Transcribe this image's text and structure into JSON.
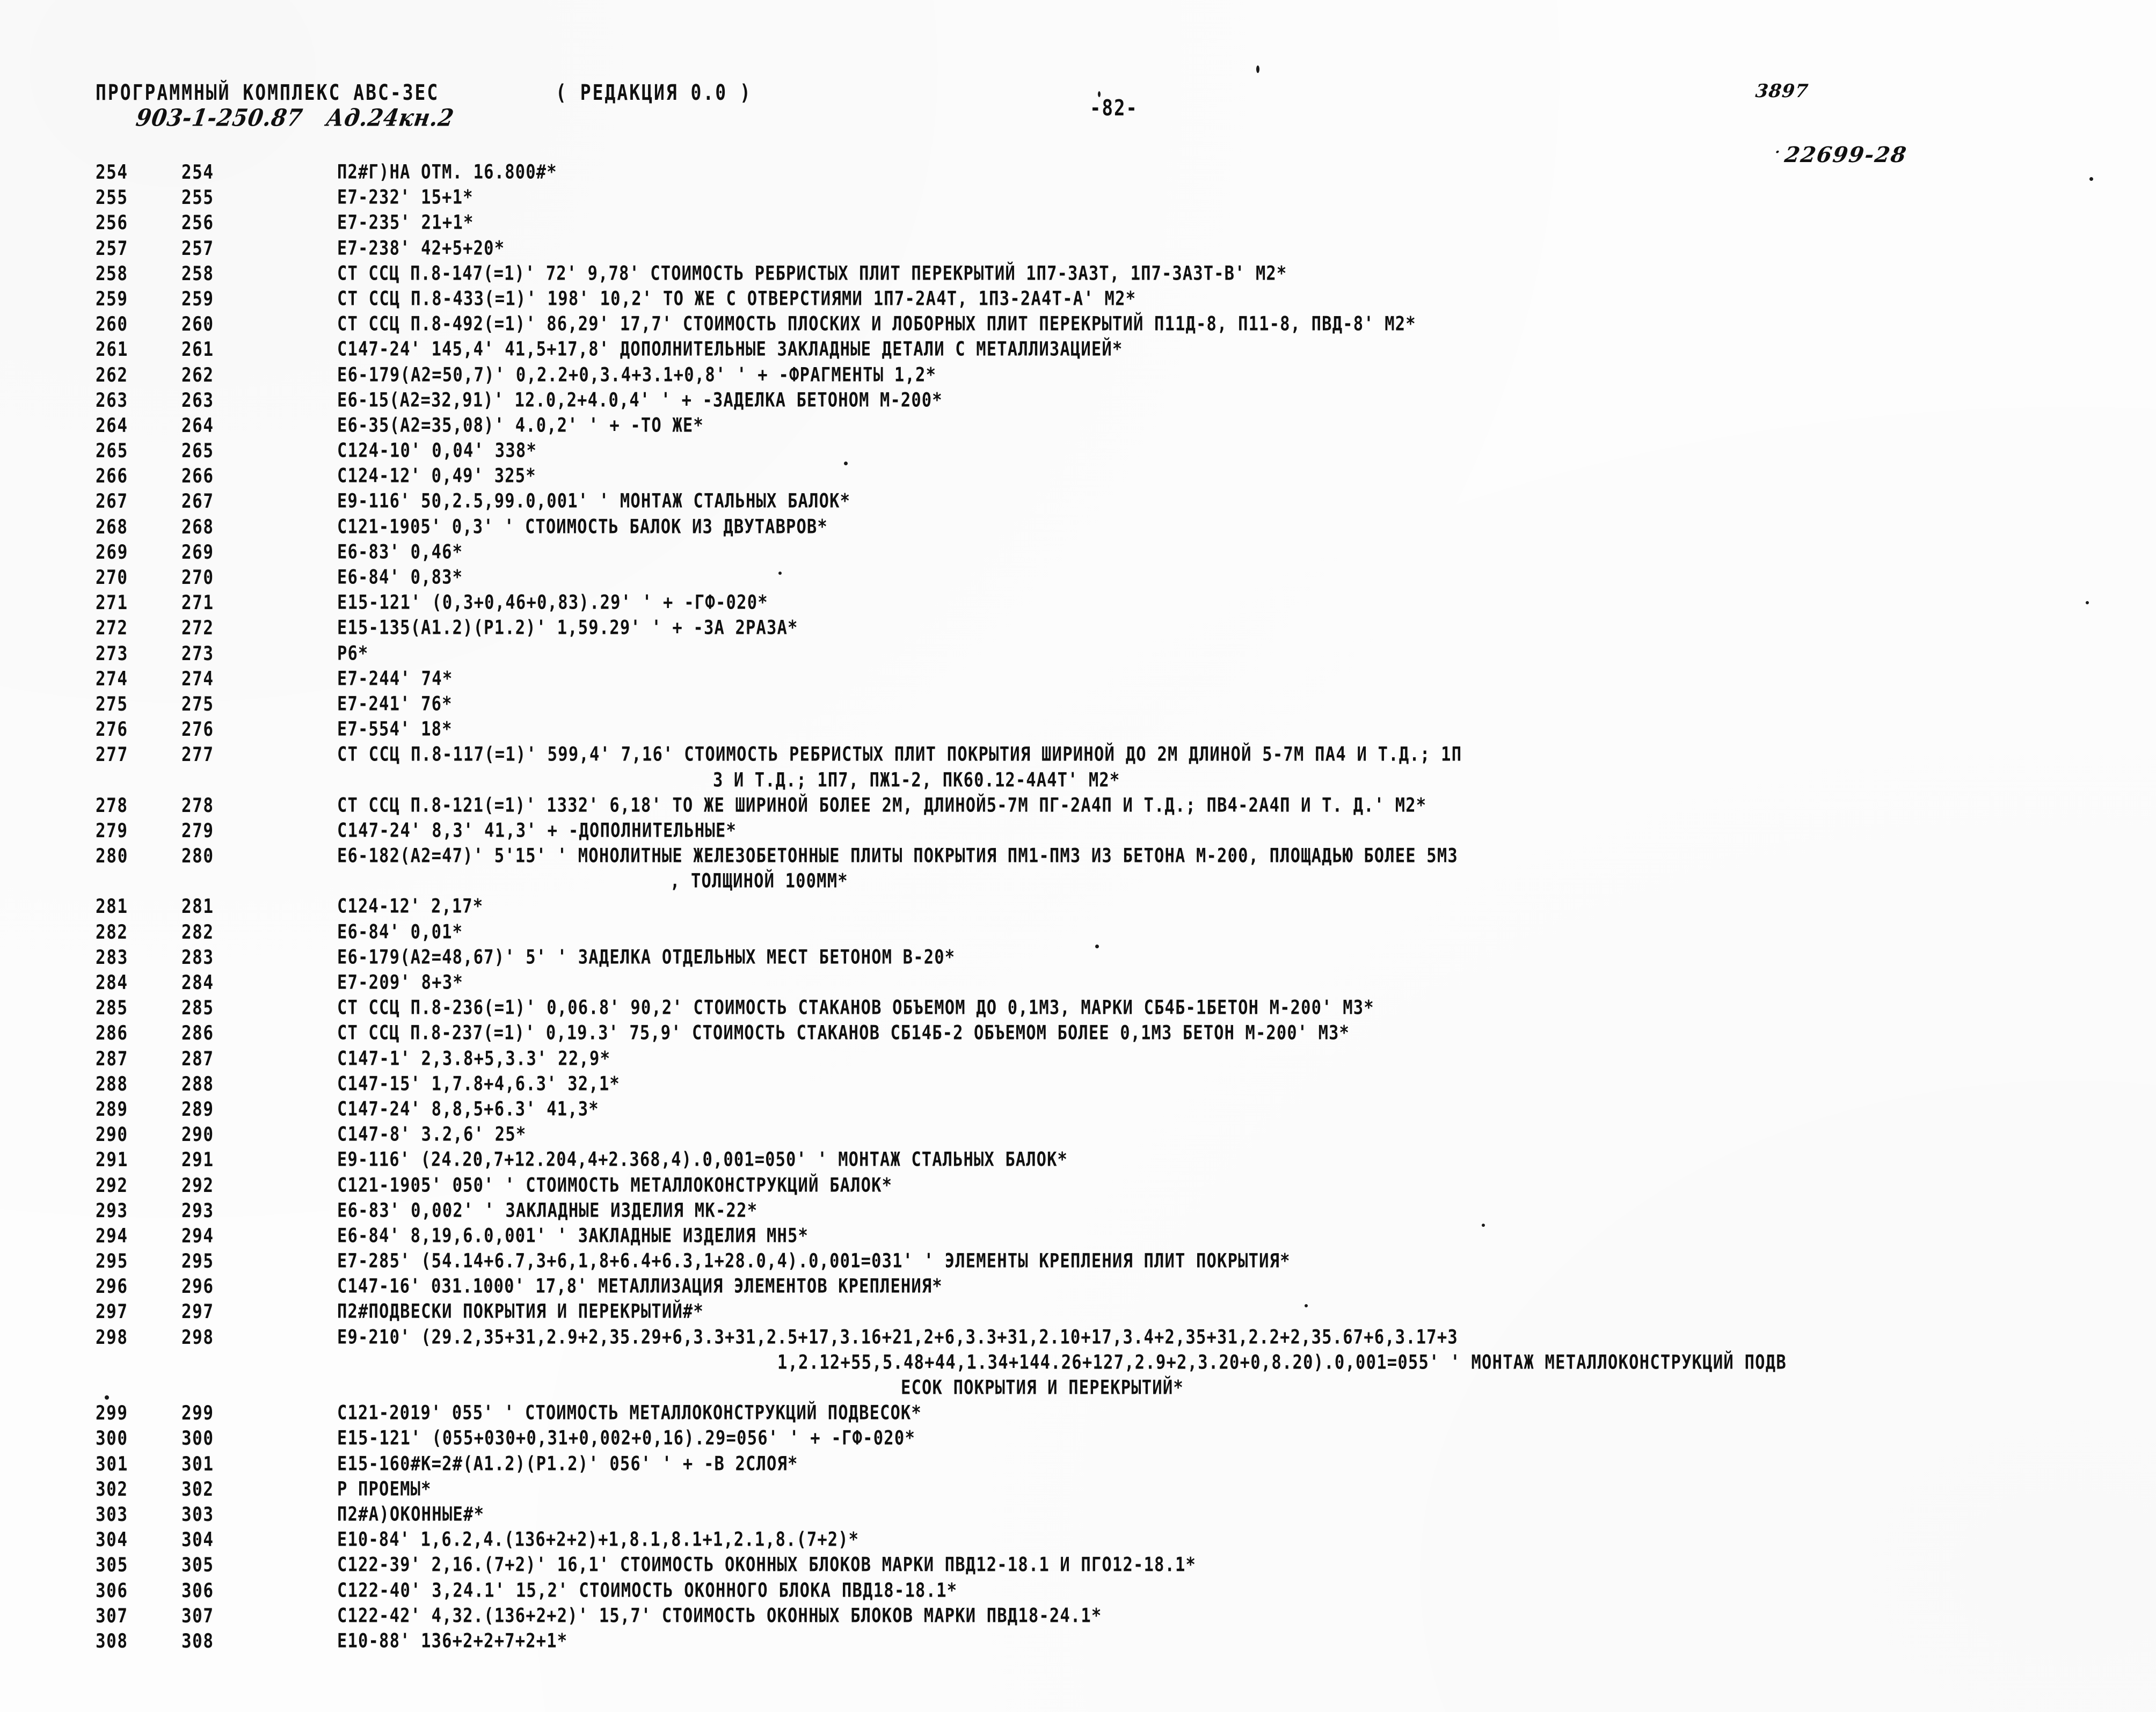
{
  "document": {
    "kind": "scanned-program-listing",
    "page_number_label": "-82-"
  },
  "header": {
    "complex_title": "ПРОГРАММНЫЙ КОМПЛЕКС АВС-3ЕС",
    "redaction": "( РЕДАКЦИЯ 0.0 )",
    "handwritten_annotation": "903-1-250.87   Ад.24кн.2",
    "page_number": "-82-",
    "code_top": "3897",
    "code_sub_tick": "·",
    "code_sub": "22699-28"
  },
  "listing": {
    "rows": [
      {
        "n1": "254",
        "n2": "254",
        "text": "П2#Г)НА ОТМ. 16.800#*"
      },
      {
        "n1": "255",
        "n2": "255",
        "text": "Е7-232' 15+1*"
      },
      {
        "n1": "256",
        "n2": "256",
        "text": "Е7-235' 21+1*"
      },
      {
        "n1": "257",
        "n2": "257",
        "text": "Е7-238' 42+5+20*"
      },
      {
        "n1": "258",
        "n2": "258",
        "text": "СТ ССЦ П.8-147(=1)' 72' 9,78' СТОИМОСТЬ РЕБРИСТЫХ ПЛИТ ПЕРЕКРЫТИЙ 1П7-3А3Т, 1П7-3А3Т-В' М2*"
      },
      {
        "n1": "259",
        "n2": "259",
        "text": "СТ ССЦ П.8-433(=1)' 198' 10,2' ТО ЖЕ С ОТВЕРСТИЯМИ 1П7-2А4Т, 1П3-2А4Т-А' М2*"
      },
      {
        "n1": "260",
        "n2": "260",
        "text": "СТ ССЦ П.8-492(=1)' 86,29' 17,7' СТОИМОСТЬ ПЛОСКИХ И ЛОБОРНЫХ ПЛИТ ПЕРЕКРЫТИЙ П11Д-8, П11-8, ПВД-8' М2*"
      },
      {
        "n1": "261",
        "n2": "261",
        "text": "С147-24' 145,4' 41,5+17,8' ДОПОЛНИТЕЛЬНЫЕ ЗАКЛАДНЫЕ ДЕТАЛИ С МЕТАЛЛИЗАЦИЕЙ*"
      },
      {
        "n1": "262",
        "n2": "262",
        "text": "Е6-179(А2=50,7)' 0,2.2+0,3.4+3.1+0,8' ' + -ФРАГМЕНТЫ 1,2*"
      },
      {
        "n1": "263",
        "n2": "263",
        "text": "Е6-15(А2=32,91)' 12.0,2+4.0,4' ' + -ЗАДЕЛКА БЕТОНОМ М-200*"
      },
      {
        "n1": "264",
        "n2": "264",
        "text": "Е6-35(А2=35,08)' 4.0,2' ' + -ТО ЖЕ*"
      },
      {
        "n1": "265",
        "n2": "265",
        "text": "С124-10' 0,04' 338*"
      },
      {
        "n1": "266",
        "n2": "266",
        "text": "С124-12' 0,49' 325*"
      },
      {
        "n1": "267",
        "n2": "267",
        "text": "Е9-116' 50,2.5,99.0,001' ' МОНТАЖ СТАЛЬНЫХ БАЛОК*"
      },
      {
        "n1": "268",
        "n2": "268",
        "text": "С121-1905' 0,3' ' СТОИМОСТЬ БАЛОК ИЗ ДВУТАВРОВ*"
      },
      {
        "n1": "269",
        "n2": "269",
        "text": "Е6-83' 0,46*"
      },
      {
        "n1": "270",
        "n2": "270",
        "text": "Е6-84' 0,83*"
      },
      {
        "n1": "271",
        "n2": "271",
        "text": "Е15-121' (0,3+0,46+0,83).29' ' + -ГФ-020*"
      },
      {
        "n1": "272",
        "n2": "272",
        "text": "Е15-135(А1.2)(Р1.2)' 1,59.29' ' + -ЗА 2РАЗА*"
      },
      {
        "n1": "273",
        "n2": "273",
        "text": "Р6*"
      },
      {
        "n1": "274",
        "n2": "274",
        "text": "Е7-244' 74*"
      },
      {
        "n1": "275",
        "n2": "275",
        "text": "Е7-241' 76*"
      },
      {
        "n1": "276",
        "n2": "276",
        "text": "Е7-554' 18*"
      },
      {
        "n1": "277",
        "n2": "277",
        "text": "СТ ССЦ П.8-117(=1)' 599,4' 7,16' СТОИМОСТЬ РЕБРИСТЫХ ПЛИТ ПОКРЫТИЯ ШИРИНОЙ ДО 2М ДЛИНОЙ 5-7М ПА4 И Т.Д.; 1П",
        "cont": "3 И Т.Д.; 1П7, ПЖ1-2, ПК60.12-4А4Т' М2*",
        "cont_indent": 700
      },
      {
        "n1": "278",
        "n2": "278",
        "text": "СТ ССЦ П.8-121(=1)' 1332' 6,18' ТО ЖЕ ШИРИНОЙ БОЛЕЕ 2М, ДЛИНОЙ5-7М ПГ-2А4П И Т.Д.; ПВ4-2А4П И Т. Д.' М2*"
      },
      {
        "n1": "279",
        "n2": "279",
        "text": "С147-24' 8,3' 41,3' + -ДОПОЛНИТЕЛЬНЫЕ*"
      },
      {
        "n1": "280",
        "n2": "280",
        "text": "Е6-182(А2=47)' 5'15' ' МОНОЛИТНЫЕ ЖЕЛЕЗОБЕТОННЫЕ ПЛИТЫ ПОКРЫТИЯ ПМ1-ПМ3 ИЗ БЕТОНА М-200, ПЛОЩАДЬЮ БОЛЕЕ 5М3",
        "cont": ", ТОЛЩИНОЙ 100ММ*",
        "cont_indent": 620
      },
      {
        "n1": "281",
        "n2": "281",
        "text": "С124-12' 2,17*"
      },
      {
        "n1": "282",
        "n2": "282",
        "text": "Е6-84' 0,01*"
      },
      {
        "n1": "283",
        "n2": "283",
        "text": "Е6-179(А2=48,67)' 5' ' ЗАДЕЛКА ОТДЕЛЬНЫХ МЕСТ БЕТОНОМ В-20*"
      },
      {
        "n1": "284",
        "n2": "284",
        "text": "Е7-209' 8+3*"
      },
      {
        "n1": "285",
        "n2": "285",
        "text": "СТ ССЦ П.8-236(=1)' 0,06.8' 90,2' СТОИМОСТЬ СТАКАНОВ ОБЪЕМОМ ДО 0,1М3, МАРКИ СБ4Б-1БЕТОН М-200' М3*"
      },
      {
        "n1": "286",
        "n2": "286",
        "text": "СТ ССЦ П.8-237(=1)' 0,19.3' 75,9' СТОИМОСТЬ СТАКАНОВ СБ14Б-2 ОБЪЕМОМ БОЛЕЕ 0,1М3 БЕТОН М-200' М3*"
      },
      {
        "n1": "287",
        "n2": "287",
        "text": "С147-1' 2,3.8+5,3.3' 22,9*"
      },
      {
        "n1": "288",
        "n2": "288",
        "text": "С147-15' 1,7.8+4,6.3' 32,1*"
      },
      {
        "n1": "289",
        "n2": "289",
        "text": "С147-24' 8,8,5+6.3' 41,3*"
      },
      {
        "n1": "290",
        "n2": "290",
        "text": "С147-8' 3.2,6' 25*"
      },
      {
        "n1": "291",
        "n2": "291",
        "text": "Е9-116' (24.20,7+12.204,4+2.368,4).0,001=050' ' МОНТАЖ СТАЛЬНЫХ БАЛОК*"
      },
      {
        "n1": "292",
        "n2": "292",
        "text": "С121-1905' 050' ' СТОИМОСТЬ МЕТАЛЛОКОНСТРУКЦИЙ БАЛОК*"
      },
      {
        "n1": "293",
        "n2": "293",
        "text": "Е6-83' 0,002' ' ЗАКЛАДНЫЕ ИЗДЕЛИЯ МК-22*"
      },
      {
        "n1": "294",
        "n2": "294",
        "text": "Е6-84' 8,19,6.0,001' ' ЗАКЛАДНЫЕ ИЗДЕЛИЯ МН5*"
      },
      {
        "n1": "295",
        "n2": "295",
        "text": "Е7-285' (54.14+6.7,3+6,1,8+6.4+6.3,1+28.0,4).0,001=031' ' ЭЛЕМЕНТЫ КРЕПЛЕНИЯ ПЛИТ ПОКРЫТИЯ*"
      },
      {
        "n1": "296",
        "n2": "296",
        "text": "С147-16' 031.1000' 17,8' МЕТАЛЛИЗАЦИЯ ЭЛЕМЕНТОВ КРЕПЛЕНИЯ*"
      },
      {
        "n1": "297",
        "n2": "297",
        "text": "П2#ПОДВЕСКИ ПОКРЫТИЯ И ПЕРЕКРЫТИЙ#*"
      },
      {
        "n1": "298",
        "n2": "298",
        "text": "Е9-210' (29.2,35+31,2.9+2,35.29+6,3.3+31,2.5+17,3.16+21,2+6,3.3+31,2.10+17,3.4+2,35+31,2.2+2,35.67+6,3.17+3",
        "cont": "1,2.12+55,5.48+44,1.34+144.26+127,2.9+2,3.20+0,8.20).0,001=055' ' МОНТАЖ МЕТАЛЛОКОНСТРУКЦИЙ ПОДВ",
        "cont_indent": 820,
        "cont2": "ЕСОК ПОКРЫТИЯ И ПЕРЕКРЫТИЙ*",
        "cont2_indent": 1050
      },
      {
        "n1": "299",
        "n2": "299",
        "text": "С121-2019' 055' ' СТОИМОСТЬ МЕТАЛЛОКОНСТРУКЦИЙ ПОДВЕСОК*"
      },
      {
        "n1": "300",
        "n2": "300",
        "text": "Е15-121' (055+030+0,31+0,002+0,16).29=056' ' + -ГФ-020*"
      },
      {
        "n1": "301",
        "n2": "301",
        "text": "Е15-160#К=2#(А1.2)(Р1.2)' 056' ' + -В 2СЛОЯ*"
      },
      {
        "n1": "302",
        "n2": "302",
        "text": "Р ПРОЕМЫ*"
      },
      {
        "n1": "303",
        "n2": "303",
        "text": "П2#А)ОКОННЫЕ#*"
      },
      {
        "n1": "304",
        "n2": "304",
        "text": "Е10-84' 1,6.2,4.(136+2+2)+1,8.1,8.1+1,2.1,8.(7+2)*"
      },
      {
        "n1": "305",
        "n2": "305",
        "text": "С122-39' 2,16.(7+2)' 16,1' СТОИМОСТЬ ОКОННЫХ БЛОКОВ МАРКИ ПВД12-18.1 И ПГО12-18.1*"
      },
      {
        "n1": "306",
        "n2": "306",
        "text": "С122-40' 3,24.1' 15,2' СТОИМОСТЬ ОКОННОГО БЛОКА ПВД18-18.1*"
      },
      {
        "n1": "307",
        "n2": "307",
        "text": "С122-42' 4,32.(136+2+2)' 15,7' СТОИМОСТЬ ОКОННЫХ БЛОКОВ МАРКИ ПВД18-24.1*"
      },
      {
        "n1": "308",
        "n2": "308",
        "text": "Е10-88' 136+2+2+7+2+1*"
      }
    ]
  }
}
